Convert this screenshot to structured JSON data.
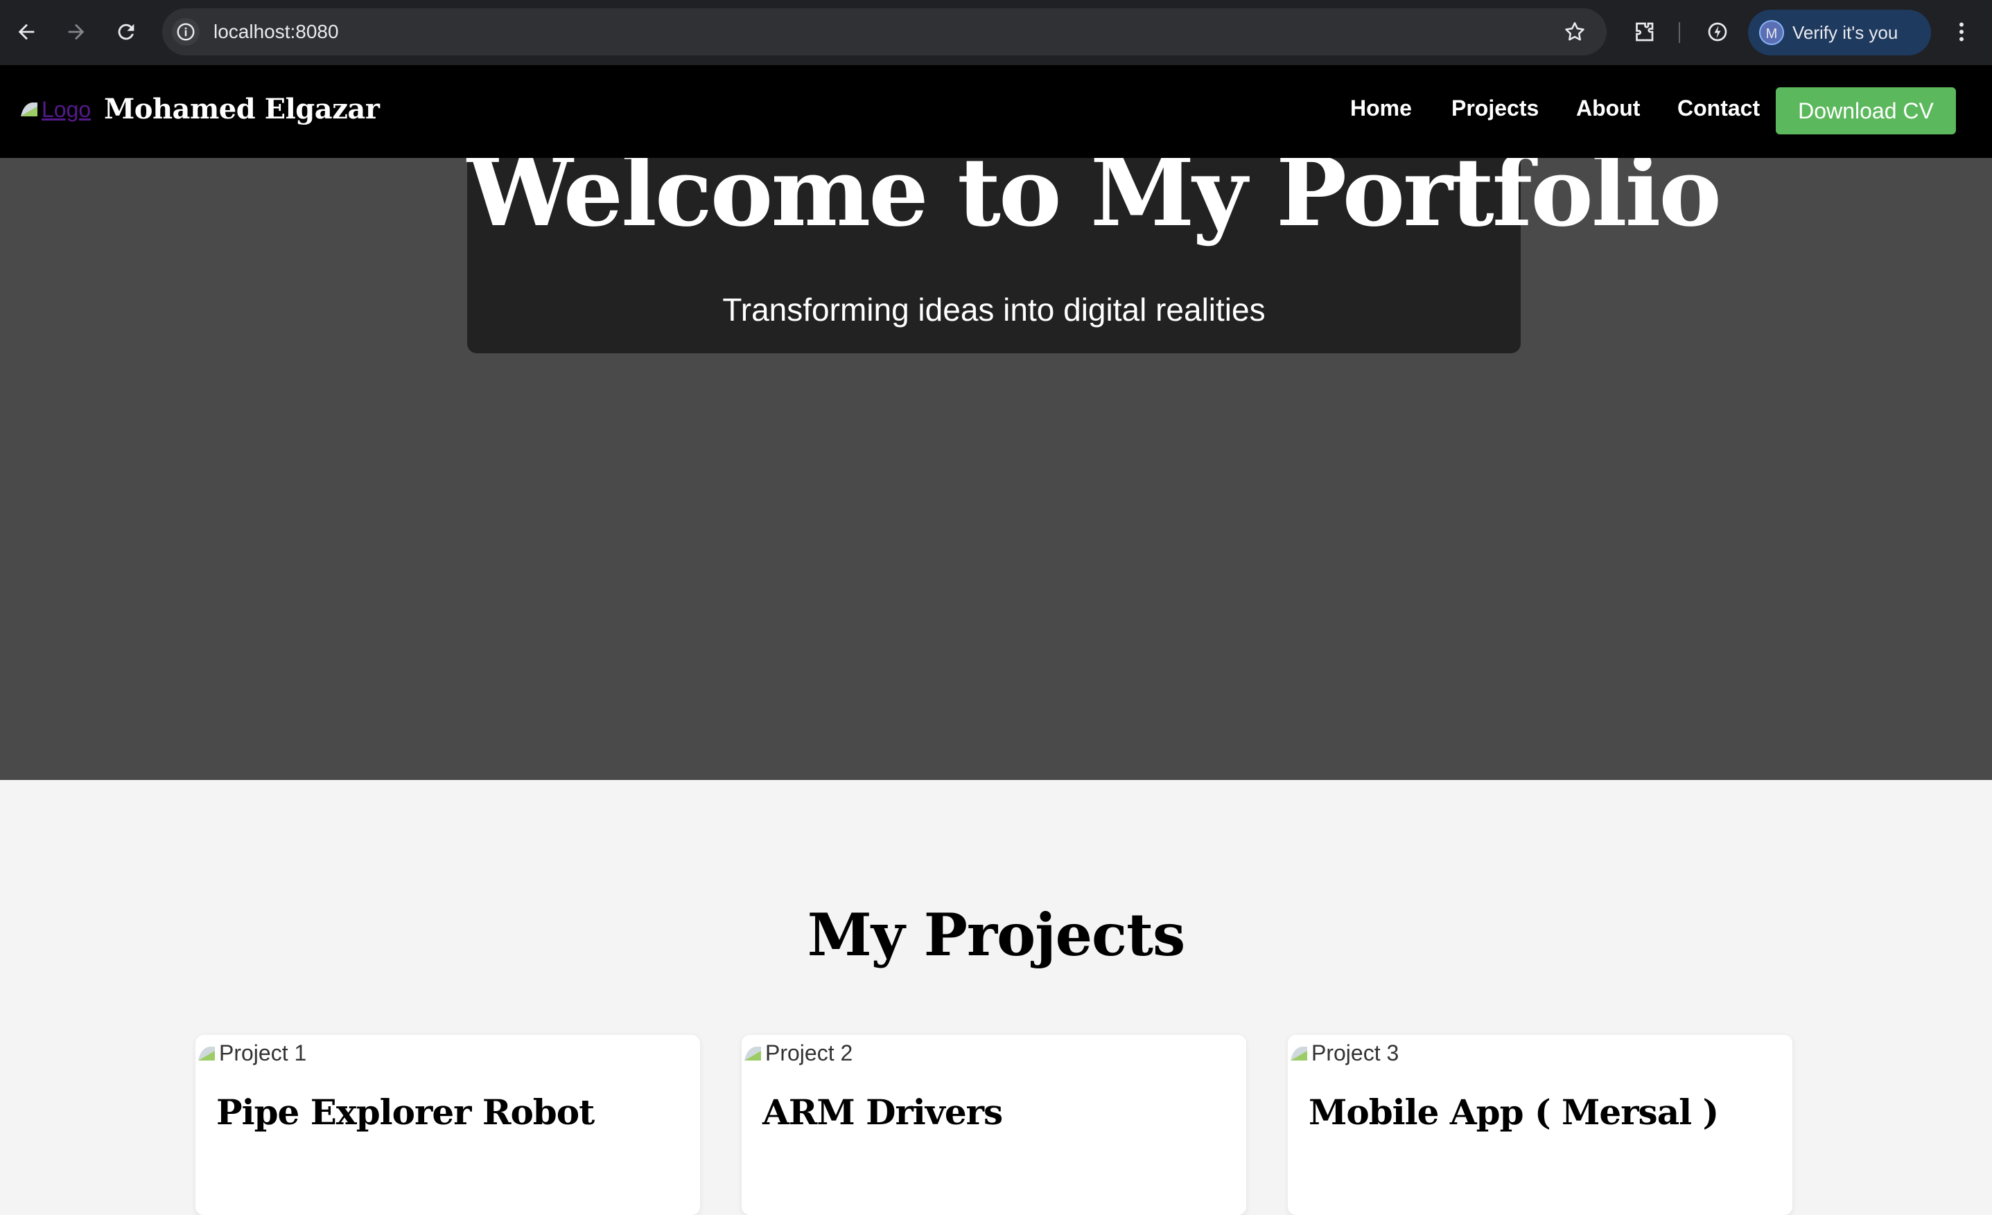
{
  "browser": {
    "url": "localhost:8080",
    "profile_initial": "M",
    "profile_label": "Verify it's you"
  },
  "header": {
    "logo_alt": "Logo",
    "brand": "Mohamed Elgazar",
    "nav": [
      "Home",
      "Projects",
      "About",
      "Contact"
    ],
    "cv_button": "Download CV",
    "cv_color": "#5cb85c"
  },
  "hero": {
    "title": "Welcome to My Portfolio",
    "subtitle": "Transforming ideas into digital realities"
  },
  "projects": {
    "title": "My Projects",
    "cards": [
      {
        "img_alt": "Project 1",
        "title": "Pipe Explorer Robot"
      },
      {
        "img_alt": "Project 2",
        "title": "ARM Drivers"
      },
      {
        "img_alt": "Project 3",
        "title": "Mobile App ( Mersal )"
      }
    ]
  }
}
